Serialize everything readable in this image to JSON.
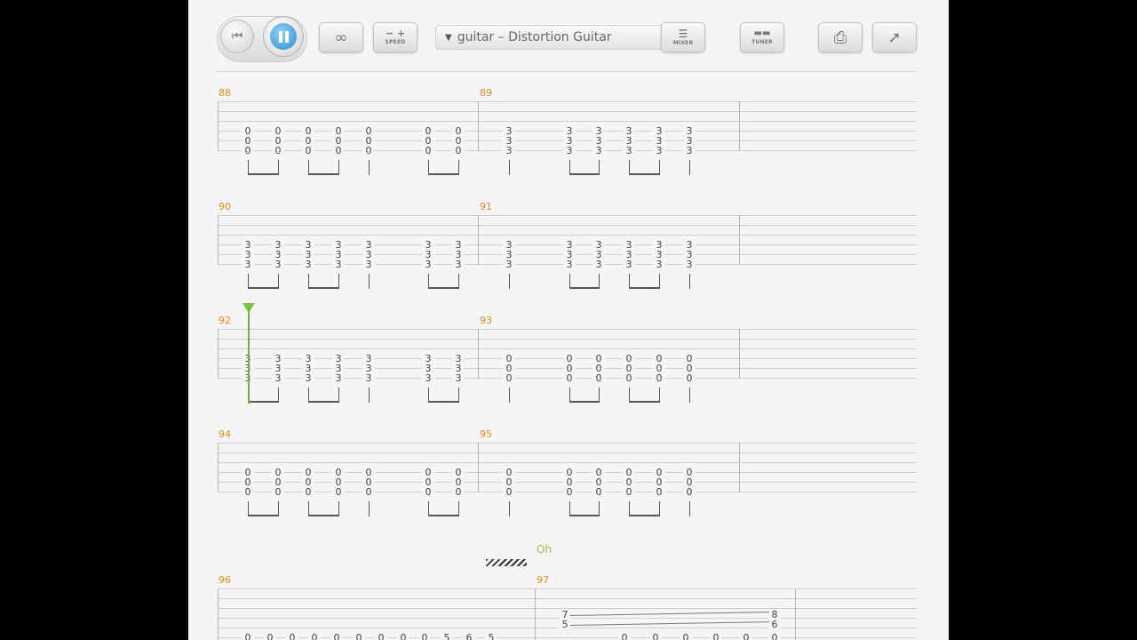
{
  "toolbar": {
    "speed_label": "SPEED",
    "mixer_label": "MIXER",
    "tuner_label": "TUNER",
    "track_name": "guitar – Distortion Guitar",
    "icons": {
      "rewind": "rewind-icon",
      "pause": "pause-icon",
      "loop": "loop-icon",
      "speed": "speed-icon",
      "dropdown": "chevron-down-icon",
      "mixer": "mixer-icon",
      "tuner": "tuner-icon",
      "print": "print-icon",
      "share": "external-link-icon"
    },
    "colors": {
      "pause_accent": "#3aa3e0",
      "measure_number": "#e08a1c",
      "cursor": "#7dc143"
    }
  },
  "score": {
    "systems": [
      {
        "measures": [
          {
            "number": "88",
            "strings": [
              "0",
              "0",
              "0"
            ],
            "chords": [
              "0",
              "0",
              "0",
              "0",
              "0",
              "0",
              "0"
            ]
          },
          {
            "number": "89",
            "strings": [
              "3",
              "3",
              "3"
            ],
            "chords": [
              "3",
              "3",
              "3",
              "3",
              "3",
              "3",
              "3"
            ]
          }
        ]
      },
      {
        "measures": [
          {
            "number": "90",
            "chords": [
              "3",
              "3",
              "3",
              "3",
              "3",
              "3",
              "3"
            ]
          },
          {
            "number": "91",
            "chords": [
              "3",
              "3",
              "3",
              "3",
              "3",
              "3",
              "3"
            ]
          }
        ]
      },
      {
        "measures": [
          {
            "number": "92",
            "chords": [
              "3",
              "3",
              "3",
              "3",
              "3",
              "3",
              "3"
            ]
          },
          {
            "number": "93",
            "chords": [
              "0",
              "0",
              "0",
              "0",
              "0",
              "0",
              "0"
            ]
          }
        ]
      },
      {
        "measures": [
          {
            "number": "94",
            "chords": [
              "0",
              "0",
              "0",
              "0",
              "0",
              "0",
              "0"
            ]
          },
          {
            "number": "95",
            "chords": [
              "0",
              "0",
              "0",
              "0",
              "0",
              "0",
              "0"
            ]
          }
        ]
      },
      {
        "measures": [
          {
            "number": "96",
            "bottom_frets": [
              "0",
              "0",
              "0",
              "0",
              "0",
              "0",
              "0",
              "0",
              "0",
              "5",
              "6",
              "5"
            ]
          },
          {
            "number": "97",
            "slide_start": [
              "7",
              "5"
            ],
            "slide_end": [
              "8",
              "6"
            ],
            "bottom_frets": [
              "0",
              "0",
              "0",
              "0",
              "0",
              "0"
            ]
          }
        ]
      }
    ],
    "lyric": "Oh"
  }
}
